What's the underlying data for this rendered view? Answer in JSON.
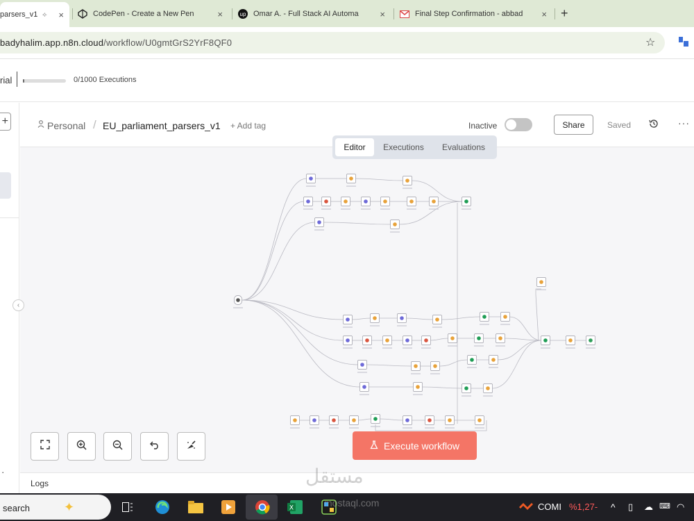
{
  "browser": {
    "tabs": [
      {
        "label": "parsers_v1",
        "close": "×",
        "active": true
      },
      {
        "label": "CodePen - Create a New Pen",
        "close": "×",
        "icon": "codepen-icon"
      },
      {
        "label": "Omar A. - Full Stack AI Automa",
        "close": "×",
        "icon": "upwork-icon"
      },
      {
        "label": "Final Step Confirmation - abbad",
        "close": "×",
        "icon": "gmail-icon"
      }
    ],
    "new_tab": "+",
    "url_host": "badyhalim.app.n8n.cloud",
    "url_path": "/workflow/U0gmtGrS2YrF8QF0"
  },
  "trial": {
    "label": "rial",
    "executions": "0/1000 Executions",
    "progress": 0.04
  },
  "header": {
    "crumb_personal": "Personal",
    "crumb_sep": "/",
    "workflow_name": "EU_parliament_parsers_v1",
    "add_tag": "+ Add tag",
    "status": "Inactive",
    "share": "Share",
    "saved": "Saved",
    "more": "···"
  },
  "view_tabs": [
    {
      "label": "Editor",
      "active": true
    },
    {
      "label": "Executions",
      "active": false
    },
    {
      "label": "Evaluations",
      "active": false
    }
  ],
  "canvas": {
    "execute_label": "Execute workflow",
    "controls": [
      "fit-view-icon",
      "zoom-in-icon",
      "zoom-out-icon",
      "undo-icon",
      "tidy-up-icon"
    ]
  },
  "logs": {
    "label": "Logs"
  },
  "taskbar": {
    "search": "search",
    "tray_app": "COMI",
    "tray_value": "%1,27-"
  },
  "watermark": {
    "main": "مستقل",
    "sub": "mostaql.com"
  },
  "colors": {
    "accent": "#f47566",
    "tab_bar": "#dfe9d5",
    "canvas_bg": "#f6f6f8"
  }
}
